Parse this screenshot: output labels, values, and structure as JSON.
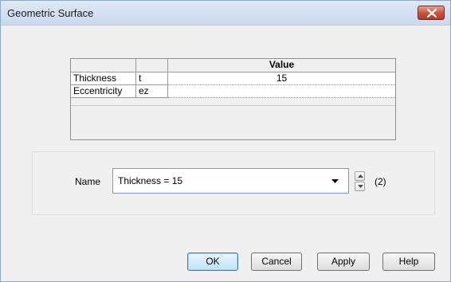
{
  "window": {
    "title": "Geometric Surface"
  },
  "table": {
    "header": {
      "col1": "",
      "col2": "",
      "value": "Value"
    },
    "rows": [
      {
        "name": "Thickness",
        "symbol": "t",
        "value": "15"
      },
      {
        "name": "Eccentricity",
        "symbol": "ez",
        "value": ""
      }
    ]
  },
  "name_field": {
    "label": "Name",
    "value": "Thickness = 15",
    "count": "(2)"
  },
  "buttons": {
    "ok": "OK",
    "cancel": "Cancel",
    "apply": "Apply",
    "help": "Help"
  },
  "icons": {
    "close": "close-icon",
    "dropdown": "chevron-down-icon",
    "spin_up": "triangle-up-icon",
    "spin_down": "triangle-down-icon"
  }
}
